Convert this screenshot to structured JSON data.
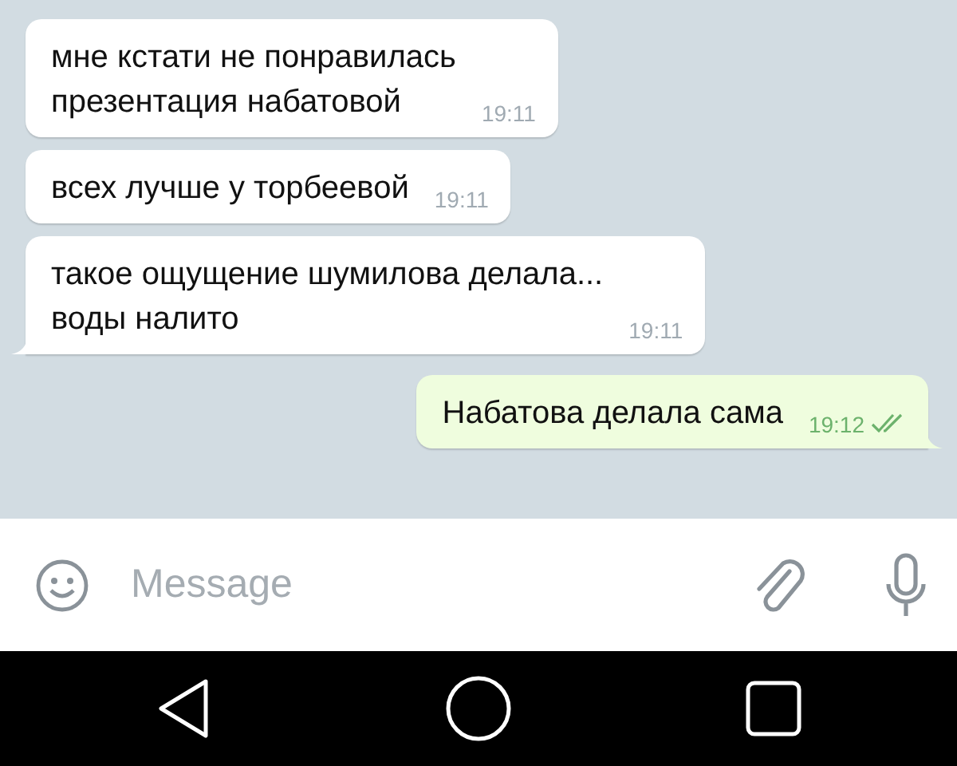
{
  "messages": [
    {
      "text": "мне кстати не понравилась\nпрезентация набатовой",
      "time": "19:11",
      "outgoing": false,
      "tail": false
    },
    {
      "text": "всех лучше у торбеевой",
      "time": "19:11",
      "outgoing": false,
      "tail": false
    },
    {
      "text": "такое ощущение шумилова делала...\nводы налито",
      "time": "19:11",
      "outgoing": false,
      "tail": true
    },
    {
      "text": "Набатова делала сама",
      "time": "19:12",
      "outgoing": true,
      "tail": true,
      "read": true
    }
  ],
  "composer": {
    "placeholder": "Message"
  }
}
